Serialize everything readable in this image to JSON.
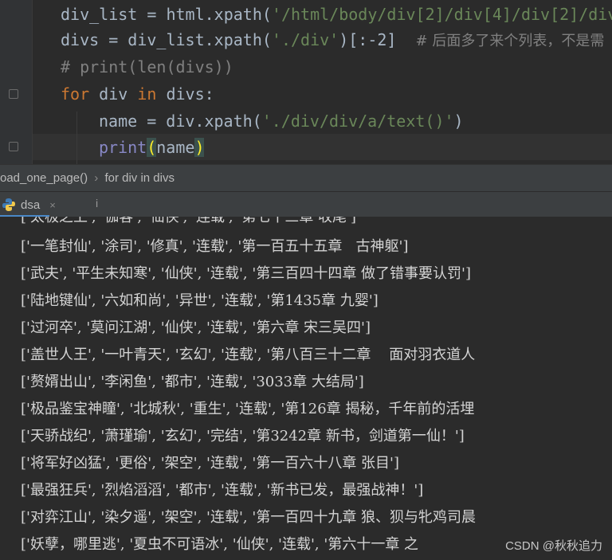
{
  "editor": {
    "line1": {
      "v": "div_list",
      "op": " = html.xpath(",
      "s": "'/html/body/div[2]/div[4]/div[2]/div"
    },
    "line2": {
      "v": "divs",
      "op": " = div_list.xpath(",
      "s": "'./div'",
      "rest": ")[:-2]  ",
      "c": "# 后面多了来个列表，不是需"
    },
    "line3": {
      "c": "# print(len(divs))"
    },
    "line4": {
      "k1": "for",
      "v": " div ",
      "k2": "in",
      "rest": " divs:"
    },
    "line5": {
      "v": "name",
      "op": " = div.xpath(",
      "s": "'./div/div/a/text()'",
      "rest": ")"
    },
    "line6": {
      "fn": "print",
      "open": "(",
      "arg": "name",
      "close": ")"
    }
  },
  "breadcrumb": {
    "fn": "oad_one_page()",
    "sep": "›",
    "block": "for div in divs"
  },
  "run": {
    "tab": "dsa",
    "close": "×",
    "marker": "i"
  },
  "console_lines": [
    "['太极之上', '伽客', '仙侠', '连载', '第七十三章 收尾']",
    "['一笔封仙', '涂司', '修真', '连载', '第一百五十五章   古神躯']",
    "['武夫', '平生未知寒', '仙侠', '连载', '第三百四十四章 做了错事要认罚']",
    "['陆地键仙', '六如和尚', '异世', '连载', '第1435章 九婴']",
    "['过河卒', '莫问江湖', '仙侠', '连载', '第六章 宋三吴四']",
    "['盖世人王', '一叶青天', '玄幻', '连载', '第八百三十二章    面对羽衣道人",
    "['赘婿出山', '李闲鱼', '都市', '连载', '3033章 大结局']",
    "['极品鉴宝神瞳', '北城秋', '重生', '连载', '第126章 揭秘，千年前的活埋",
    "['天骄战纪', '萧瑾瑜', '玄幻', '完结', '第3242章 新书，剑道第一仙！']",
    "['将军好凶猛', '更俗', '架空', '连载', '第一百六十八章 张目']",
    "['最强狂兵', '烈焰滔滔', '都市', '连载', '新书已发，最强战神！']",
    "['对弈江山', '染夕遥', '架空', '连载', '第一百四十九章 狼、狈与牝鸡司晨",
    "['妖孽，哪里逃', '夏虫不可语冰', '仙侠', '连载', '第六十一章 之"
  ],
  "watermark": "CSDN @秋秋追力",
  "colors": {
    "keyword": "#cc7832",
    "string": "#6a8759",
    "comment": "#808080",
    "builtin": "#8888c6",
    "bracket_match": "#ffef28",
    "tab_underline": "#4a88c7"
  }
}
